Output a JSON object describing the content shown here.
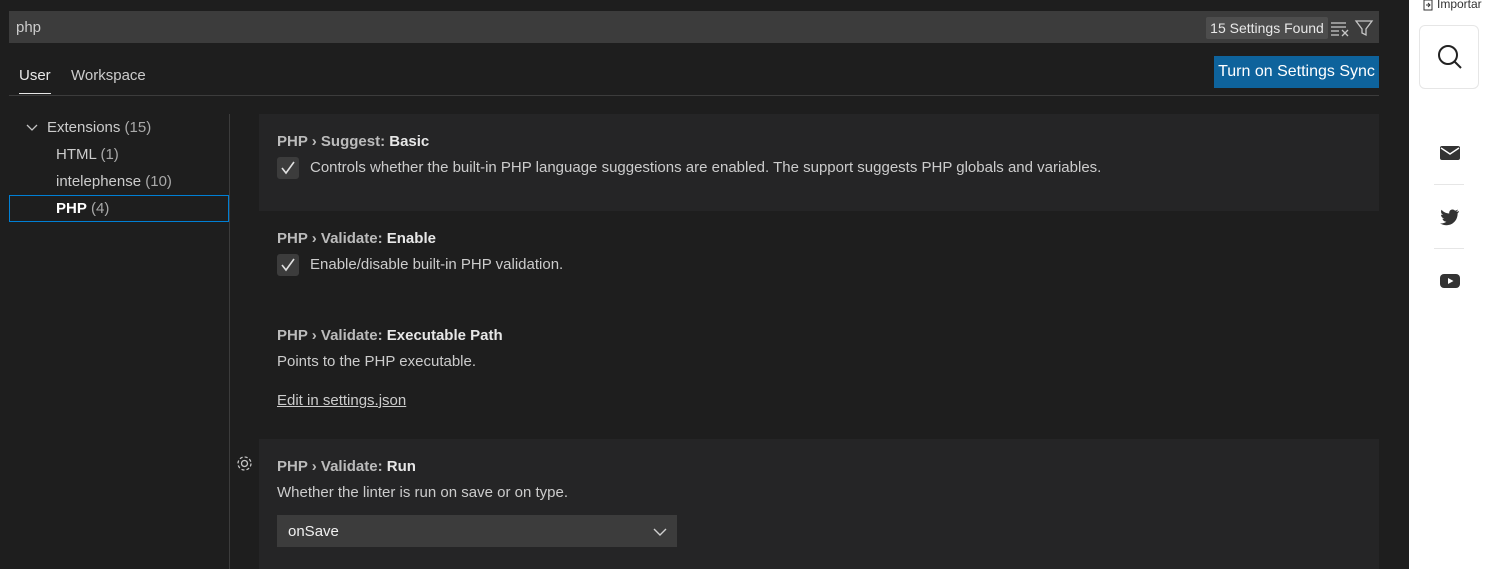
{
  "search": {
    "value": "php",
    "results_label": "15 Settings Found"
  },
  "tabs": [
    {
      "label": "User"
    },
    {
      "label": "Workspace"
    }
  ],
  "sync_button": {
    "label": "Turn on Settings Sync"
  },
  "tree": {
    "group": {
      "label": "Extensions",
      "count": "(15)"
    },
    "items": [
      {
        "label": "HTML",
        "count": "(1)"
      },
      {
        "label": "intelephense",
        "count": "(10)"
      },
      {
        "label": "PHP",
        "count": "(4)"
      }
    ]
  },
  "settings": [
    {
      "category": "PHP › Suggest: ",
      "key": "Basic",
      "checked": true,
      "description": "Controls whether the built-in PHP language suggestions are enabled. The support suggests PHP globals and variables."
    },
    {
      "category": "PHP › Validate: ",
      "key": "Enable",
      "checked": true,
      "description": "Enable/disable built-in PHP validation."
    },
    {
      "category": "PHP › Validate: ",
      "key": "Executable Path",
      "description": "Points to the PHP executable.",
      "link": "Edit in settings.json"
    },
    {
      "category": "PHP › Validate: ",
      "key": "Run",
      "description": "Whether the linter is run on save or on type.",
      "selected_value": "onSave"
    }
  ],
  "browser_sidebar": {
    "import_label": "Importar"
  },
  "colors": {
    "accent": "#0e639c",
    "focus_border": "#007fd4",
    "background": "#1e1e1e"
  }
}
